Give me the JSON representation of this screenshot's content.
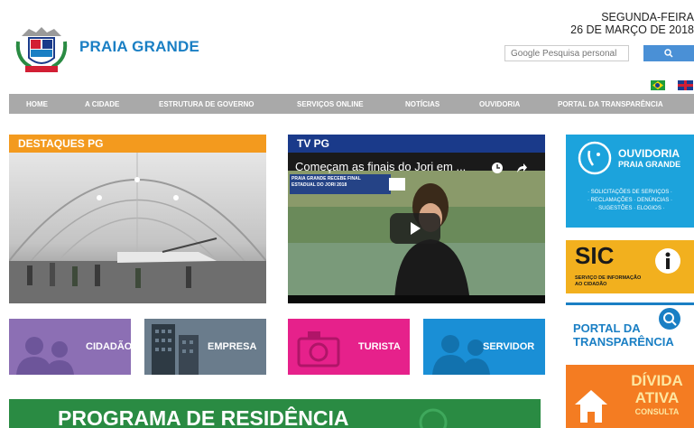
{
  "header": {
    "brand": "PRAIA GRANDE",
    "weekday": "SEGUNDA-FEIRA",
    "date": "26 DE MARÇO DE 2018",
    "search_placeholder": "Google Pesquisa personal",
    "search_icon": "search-icon"
  },
  "nav": {
    "items": [
      "HOME",
      "A CIDADE",
      "ESTRUTURA DE GOVERNO",
      "SERVIÇOS ONLINE",
      "NOTÍCIAS",
      "OUVIDORIA",
      "PORTAL DA TRANSPARÊNCIA"
    ]
  },
  "destaques": {
    "title": "DESTAQUES PG"
  },
  "tv": {
    "title": "TV PG",
    "video_title": "Começam as finais do Jori em ...",
    "caption_line1": "PRAIA GRANDE RECEBE FINAL",
    "caption_line2": "ESTADUAL DO JORI 2018"
  },
  "tiles": [
    {
      "label": "CIDADÃO",
      "color": "#8c6fb4"
    },
    {
      "label": "EMPRESA",
      "color": "#6a7c8c"
    },
    {
      "label": "TURISTA",
      "color": "#e6218b"
    },
    {
      "label": "SERVIDOR",
      "color": "#1a8fd6"
    }
  ],
  "side": {
    "ouvidoria": {
      "title": "OUVIDORIA",
      "subtitle": "PRAIA GRANDE",
      "line1": "· SOLICITAÇÕES DE SERVIÇOS ·",
      "line2": "· RECLAMAÇÕES · DENÚNCIAS ·",
      "line3": "· SUGESTÕES · ELOGIOS ·"
    },
    "sic": {
      "title": "SIC",
      "line1": "SERVIÇO DE INFORMAÇÃO",
      "line2": "AO CIDADÃO"
    },
    "portal": {
      "line1": "PORTAL DA",
      "line2": "TRANSPARÊNCIA"
    },
    "divida": {
      "line1": "DÍVIDA",
      "line2": "ATIVA",
      "line3": "CONSULTA"
    }
  },
  "banner": {
    "text": "PROGRAMA DE RESIDÊNCIA"
  },
  "colors": {
    "brand_blue": "#1a7fc4",
    "nav_gray": "#a9a9a9",
    "orange": "#f39a1e",
    "navy": "#1a3a8a"
  }
}
